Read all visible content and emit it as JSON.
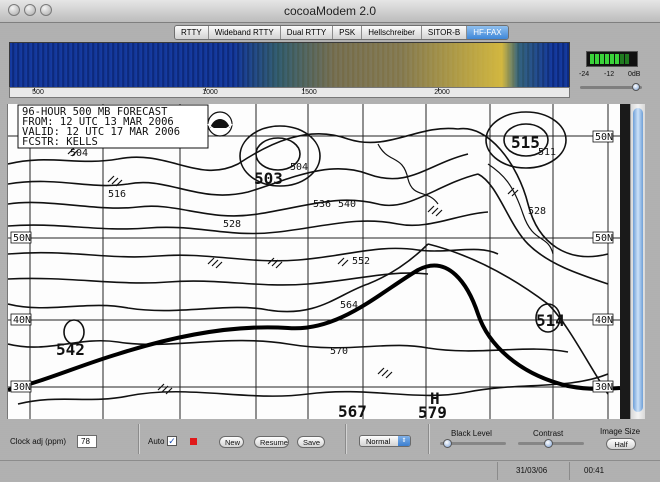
{
  "window": {
    "title": "cocoaModem 2.0"
  },
  "tabs": [
    {
      "label": "RTTY",
      "active": false
    },
    {
      "label": "Wideband RTTY",
      "active": false
    },
    {
      "label": "Dual RTTY",
      "active": false
    },
    {
      "label": "PSK",
      "active": false
    },
    {
      "label": "Hellschreiber",
      "active": false
    },
    {
      "label": "SITOR-B",
      "active": false
    },
    {
      "label": "HF-FAX",
      "active": true
    }
  ],
  "waterfall": {
    "ruler_labels": [
      "500",
      "1000",
      "1500",
      "2000"
    ]
  },
  "meter": {
    "scale": [
      "-24",
      "-12",
      "0dB"
    ]
  },
  "fax": {
    "header_lines": [
      "96-HOUR 500 MB FORECAST",
      "FROM: 12 UTC 13 MAR 2006",
      "VALID: 12 UTC 17 MAR 2006",
      "FCSTR: KELLS"
    ],
    "contour_labels": [
      "504",
      "516",
      "528",
      "536",
      "540",
      "552",
      "564",
      "570",
      "504",
      "528",
      "511"
    ],
    "pressure_labels": [
      "503",
      "542",
      "567",
      "579",
      "515",
      "514"
    ],
    "high_marker": "H",
    "latitude_labels_left": [
      "50N",
      "40N",
      "30N"
    ],
    "latitude_labels_right": [
      "50N",
      "50N",
      "40N",
      "30N"
    ]
  },
  "controls": {
    "clock_adj_label": "Clock adj (ppm)",
    "clock_adj_value": "78",
    "auto_label": "Auto",
    "auto_checked": true,
    "new_label": "New",
    "resume_label": "Resume",
    "save_label": "Save",
    "mode_popup": "Normal",
    "black_level_label": "Black Level",
    "contrast_label": "Contrast",
    "image_size_label": "Image Size",
    "half_label": "Half"
  },
  "status": {
    "date": "31/03/06",
    "time": "00:41"
  },
  "colors": {
    "active_tab": "#3f87d8",
    "stop_red": "#e0191a",
    "meter_green": "#3bd23b"
  }
}
